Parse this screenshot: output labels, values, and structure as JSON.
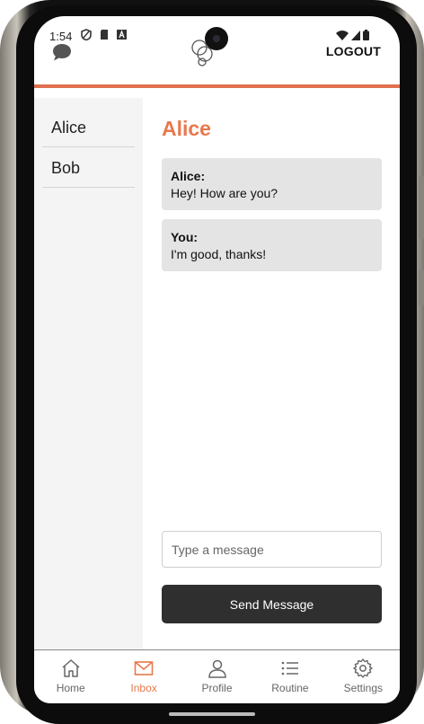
{
  "status_bar": {
    "time": "1:54"
  },
  "header": {
    "logout_label": "LOGOUT"
  },
  "sidebar": {
    "contacts": [
      {
        "name": "Alice"
      },
      {
        "name": "Bob"
      }
    ]
  },
  "chat": {
    "title": "Alice",
    "messages": [
      {
        "sender": "Alice:",
        "text": "Hey! How are you?"
      },
      {
        "sender": "You:",
        "text": "I'm good, thanks!"
      }
    ],
    "input_placeholder": "Type a message",
    "input_value": "",
    "send_label": "Send Message"
  },
  "bottom_nav": {
    "items": [
      {
        "label": "Home",
        "icon": "home-icon",
        "active": false
      },
      {
        "label": "Inbox",
        "icon": "mail-icon",
        "active": true
      },
      {
        "label": "Profile",
        "icon": "person-icon",
        "active": false
      },
      {
        "label": "Routine",
        "icon": "list-icon",
        "active": false
      },
      {
        "label": "Settings",
        "icon": "gear-icon",
        "active": false
      }
    ]
  },
  "colors": {
    "accent": "#e8784e",
    "accent_line": "#e07050",
    "button_dark": "#2f2f2f",
    "bubble": "#e4e4e4",
    "sidebar": "#f4f4f4"
  }
}
